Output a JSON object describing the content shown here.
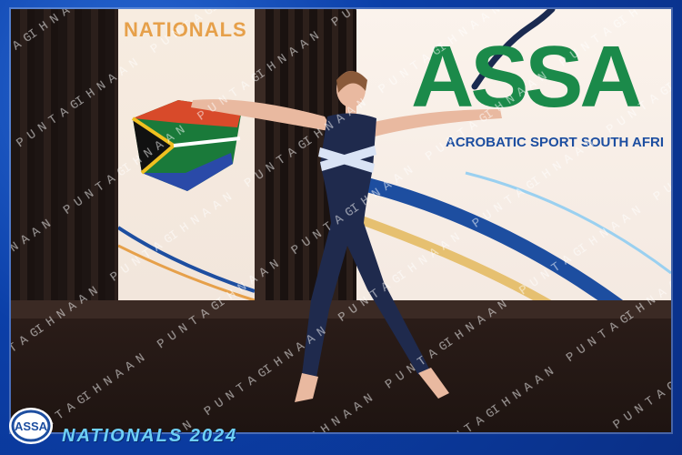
{
  "banner_left": {
    "text": "NATIONALS"
  },
  "banner_right": {
    "logo_text": "ASSA",
    "subtitle": "ACROBATIC SPORT SOUTH AFRI"
  },
  "watermark": {
    "text": "IHNAAN PUNTAGRAPHY"
  },
  "footer": {
    "logo_text": "ASSA",
    "label": "NATIONALS 2024"
  }
}
